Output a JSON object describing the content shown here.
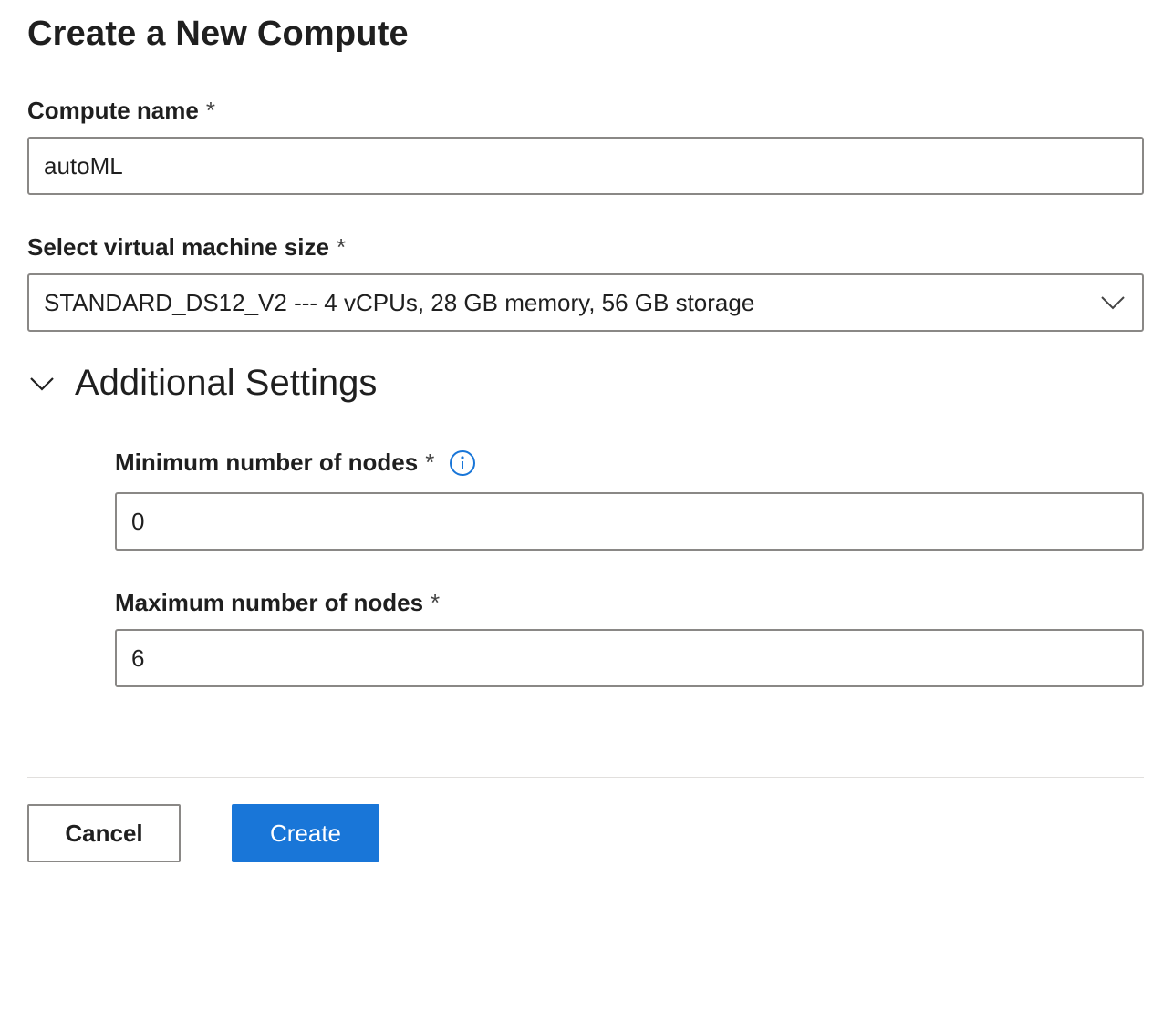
{
  "dialog": {
    "title": "Create a New Compute"
  },
  "compute_name": {
    "label": "Compute name",
    "required_mark": "*",
    "value": "autoML"
  },
  "vm_size": {
    "label": "Select virtual machine size",
    "required_mark": "*",
    "selected": "STANDARD_DS12_V2 --- 4 vCPUs, 28 GB memory, 56 GB storage"
  },
  "additional_settings": {
    "title": "Additional Settings",
    "expanded": true,
    "min_nodes": {
      "label": "Minimum number of nodes",
      "required_mark": "*",
      "value": "0"
    },
    "max_nodes": {
      "label": "Maximum number of nodes",
      "required_mark": "*",
      "value": "6"
    }
  },
  "footer": {
    "cancel_label": "Cancel",
    "create_label": "Create"
  },
  "colors": {
    "accent": "#1976d8",
    "info_icon": "#1976d8",
    "border": "#8a8886",
    "divider": "#e1dfdd"
  },
  "icons": {
    "dropdown": "chevron-down-icon",
    "section_toggle": "chevron-down-icon",
    "info": "info-icon"
  }
}
